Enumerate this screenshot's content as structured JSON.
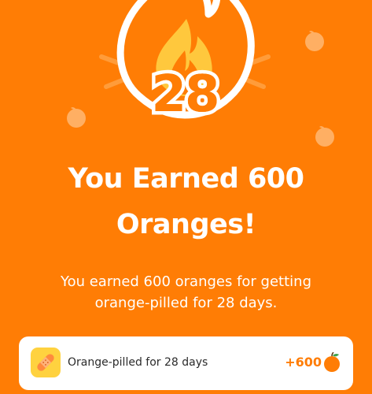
{
  "streak": {
    "count": "28"
  },
  "headline": {
    "line1": "You Earned 600",
    "line2": "Oranges!"
  },
  "message": {
    "line1": "You earned 600 oranges for getting",
    "line2": "orange-pilled for 28 days."
  },
  "reward": {
    "label": "Orange-pilled for 28 days",
    "amount": "+600",
    "icon": "bandage-icon",
    "currency_icon": "orange-icon"
  },
  "colors": {
    "background": "#ff7d05",
    "card": "#ffffff",
    "icon_tile": "#ffd23f",
    "accent": "#ff7d05"
  }
}
